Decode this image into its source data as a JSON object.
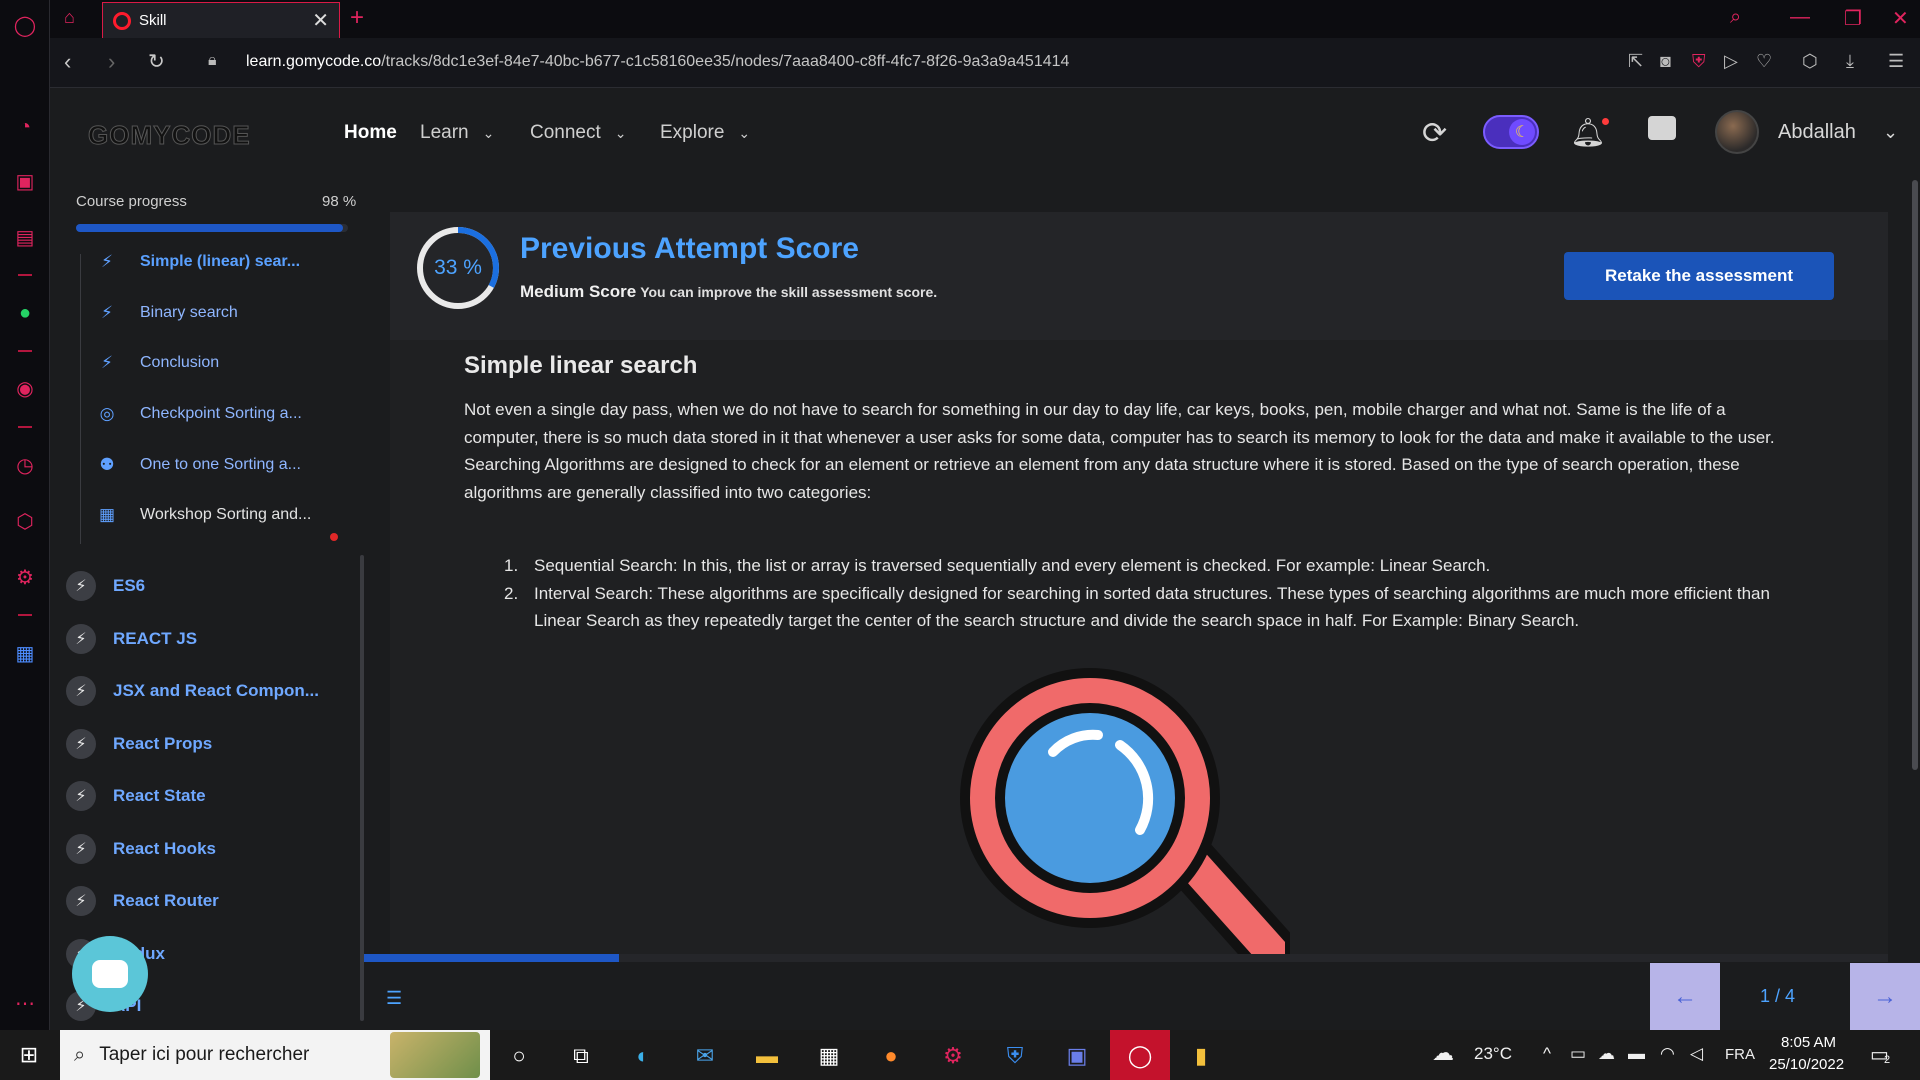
{
  "browser": {
    "tab_title": "Skill",
    "url_host": "learn.gomycode.co",
    "url_path": "/tracks/8dc1e3ef-84e7-40bc-b677-c1c58160ee35/nodes/7aaa8400-c8ff-4fc7-8f26-9a3a9a451414"
  },
  "header": {
    "logo": "GOMYCODE",
    "nav": [
      {
        "label": "Home",
        "active": true
      },
      {
        "label": "Learn"
      },
      {
        "label": "Connect"
      },
      {
        "label": "Explore"
      }
    ],
    "user_name": "Abdallah"
  },
  "sidebar": {
    "progress_label": "Course progress",
    "progress_value": "98 %",
    "progress_fraction": 0.98,
    "sub_items": [
      {
        "label": "Simple (linear) sear...",
        "icon": "bolt-icon"
      },
      {
        "label": "Binary search",
        "icon": "bolt-icon"
      },
      {
        "label": "Conclusion",
        "icon": "bolt-icon"
      },
      {
        "label": "Checkpoint Sorting a...",
        "icon": "target-icon"
      },
      {
        "label": "One to one Sorting a...",
        "icon": "people-icon"
      },
      {
        "label": "Workshop Sorting and...",
        "icon": "workshop-icon"
      }
    ],
    "modules": [
      {
        "label": "ES6"
      },
      {
        "label": "REACT JS"
      },
      {
        "label": "JSX and React Compon..."
      },
      {
        "label": "React Props"
      },
      {
        "label": "React State"
      },
      {
        "label": "React Hooks"
      },
      {
        "label": "React Router"
      },
      {
        "label": "Redux"
      },
      {
        "label": "API"
      }
    ]
  },
  "score": {
    "percent": "33 %",
    "percent_value": 33,
    "title": "Previous Attempt Score",
    "level": "Medium Score",
    "hint": "You can improve the skill assessment score.",
    "retake_label": "Retake the assessment"
  },
  "lesson": {
    "title": "Simple linear search",
    "para1": "Not even a single day pass, when we do not have to search for something in our day to day life, car keys, books, pen, mobile charger and what not. Same is the life of a computer, there is so much data stored in it that whenever a user asks for some data, computer has to search its memory to look for the data and make it available to the user.",
    "para2": "Searching Algorithms are designed to check for an element or retrieve an element from any data structure where it is stored. Based on the type of search operation, these algorithms are generally classified into two categories:",
    "list": [
      {
        "num": "1.",
        "text": "Sequential Search: In this, the list or array is traversed sequentially and every element is checked. For example: Linear Search."
      },
      {
        "num": "2.",
        "text": "Interval Search: These algorithms are specifically designed for searching in sorted data structures. These types of searching algorithms are much more efficient than Linear Search as they repeatedly target the center of the search structure and divide the search space in half. For Example: Binary Search."
      }
    ],
    "page_progress_fraction": 0.167,
    "pager": "1 / 4"
  },
  "taskbar": {
    "search_placeholder": "Taper ici pour rechercher",
    "weather": "23°C",
    "language": "FRA",
    "time": "8:05 AM",
    "date": "25/10/2022",
    "notifications": "2"
  },
  "colors": {
    "accent_blue": "#4da3ff",
    "button_blue": "#1b54b8",
    "opera_red": "#e0245e"
  }
}
